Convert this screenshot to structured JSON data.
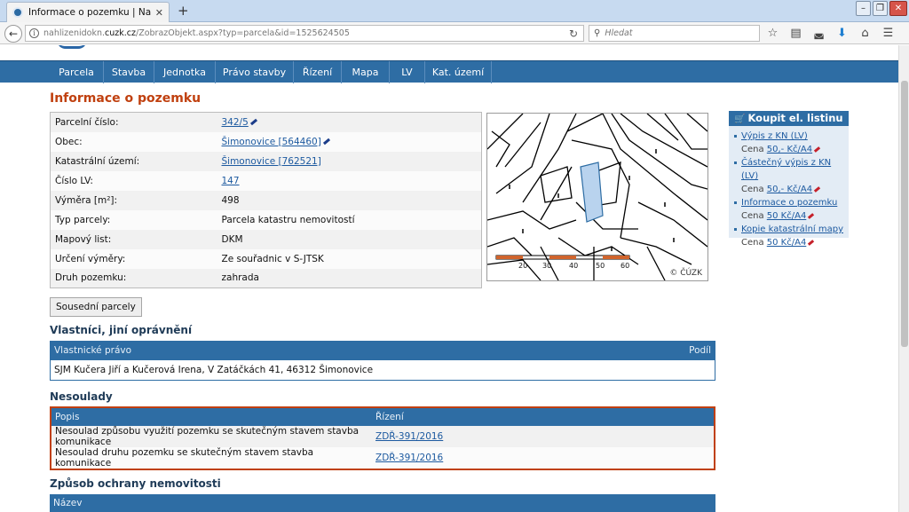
{
  "browser": {
    "tab_title": "Informace o pozemku | Nahlí",
    "url_prefix": "nahlizenidokn.",
    "url_domain": "cuzk.cz",
    "url_path": "/ZobrazObjekt.aspx?typ=parcela&id=1525624505",
    "search_placeholder": "Hledat"
  },
  "menu": [
    "Parcela",
    "Stavba",
    "Jednotka",
    "Právo stavby",
    "Řízení",
    "Mapa",
    "LV",
    "Kat. území"
  ],
  "page_title": "Informace o pozemku",
  "properties": [
    {
      "label": "Parcelní číslo:",
      "value": "342/5",
      "link": true,
      "edit": true
    },
    {
      "label": "Obec:",
      "value": "Šimonovice [564460]",
      "link": true,
      "edit": true
    },
    {
      "label": "Katastrální území:",
      "value": "Šimonovice [762521]",
      "link": true,
      "edit": false
    },
    {
      "label": "Číslo LV:",
      "value": "147",
      "link": true,
      "edit": false
    },
    {
      "label": "Výměra [m²]:",
      "value": "498",
      "link": false,
      "edit": false
    },
    {
      "label": "Typ parcely:",
      "value": "Parcela katastru nemovitostí",
      "link": false,
      "edit": false
    },
    {
      "label": "Mapový list:",
      "value": "DKM",
      "link": false,
      "edit": false
    },
    {
      "label": "Určení výměry:",
      "value": "Ze souřadnic v S-JTSK",
      "link": false,
      "edit": false
    },
    {
      "label": "Druh pozemku:",
      "value": "zahrada",
      "link": false,
      "edit": false
    }
  ],
  "map": {
    "copyright": "© ČÚZK",
    "scale_labels": [
      "20",
      "30",
      "40",
      "50",
      "60"
    ]
  },
  "neighbors_button": "Sousední parcely",
  "sidebar": {
    "title": "Koupit el. listinu",
    "items": [
      {
        "label": "Výpis z KN (LV)",
        "price_prefix": "Cena ",
        "price": "50,- Kč/A4"
      },
      {
        "label": "Částečný výpis z KN (LV)",
        "price_prefix": "Cena ",
        "price": "50,- Kč/A4"
      },
      {
        "label": "Informace o pozemku",
        "price_prefix": "Cena ",
        "price": "50 Kč/A4"
      },
      {
        "label": "Kopie katastrální mapy",
        "price_prefix": "Cena ",
        "price": "50 Kč/A4"
      }
    ]
  },
  "owners": {
    "heading": "Vlastníci, jiní oprávnění",
    "col_right": "Vlastnické právo",
    "col_share": "Podíl",
    "rows": [
      "SJM Kučera Jiří a Kučerová Irena, V Zatáčkách 41, 46312 Šimonovice"
    ]
  },
  "conflicts": {
    "heading": "Nesoulady",
    "col_desc": "Popis",
    "col_proc": "Řízení",
    "rows": [
      {
        "desc": "Nesoulad způsobu využití pozemku se skutečným stavem stavba komunikace",
        "proc": "ZDŘ-391/2016"
      },
      {
        "desc": "Nesoulad druhu pozemku se skutečným stavem stavba komunikace",
        "proc": "ZDŘ-391/2016"
      }
    ]
  },
  "protection": {
    "heading": "Způsob ochrany nemovitosti",
    "col_name": "Název"
  }
}
